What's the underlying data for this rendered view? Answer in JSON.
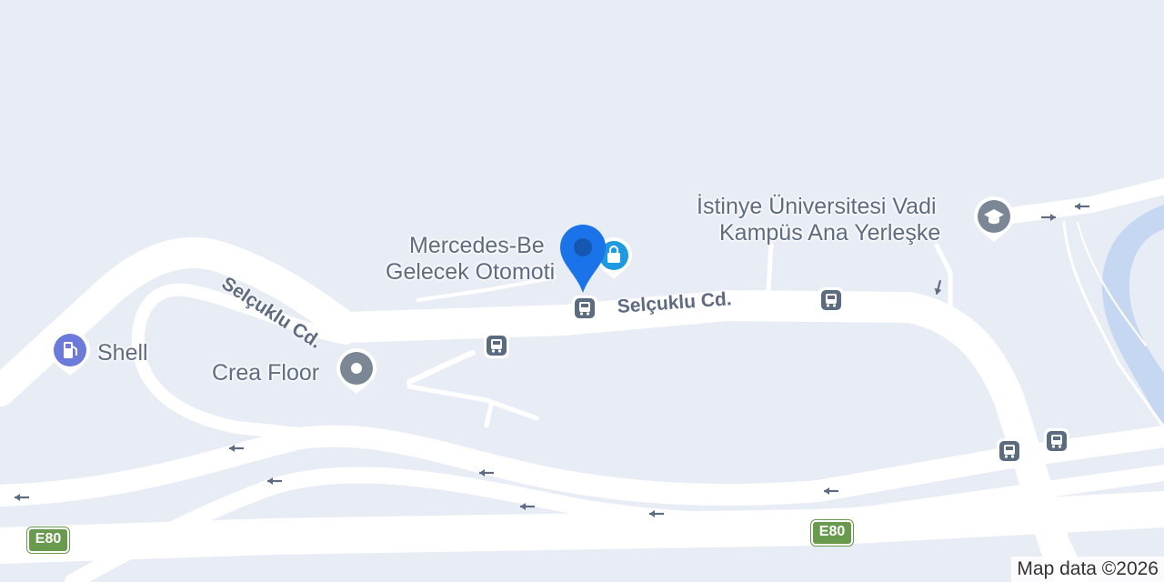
{
  "map": {
    "background_color": "#e8ecf5",
    "road_color": "#ffffff",
    "water_color": "#c6d7f2",
    "road_label_color": "#5f6b80"
  },
  "pois": {
    "mercedes": {
      "name_line1": "Mercedes-Be",
      "name_line2": "Gelecek Otomoti",
      "icon": "shopping-bag-icon",
      "color": "#1e9be0"
    },
    "istinye": {
      "name_line1": "İstinye Üniversitesi Vadi",
      "name_line2": "Kampüs Ana Yerleşke",
      "icon": "graduation-cap-icon",
      "color": "#7b8794"
    },
    "shell": {
      "name": "Shell",
      "icon": "gas-station-icon",
      "color": "#6c7bd9"
    },
    "crea": {
      "name": "Crea Floor",
      "icon": "generic-place-icon",
      "color": "#7b8794"
    }
  },
  "roads": {
    "selcuklu_1": "Selçuklu Cd.",
    "selcuklu_2": "Selçuklu Cd."
  },
  "highway_shields": [
    "E80",
    "E80"
  ],
  "selected_pin": {
    "color": "#1a73e8"
  },
  "bus_stop_icon": "bus-stop-icon",
  "attribution": "Map data ©2026"
}
